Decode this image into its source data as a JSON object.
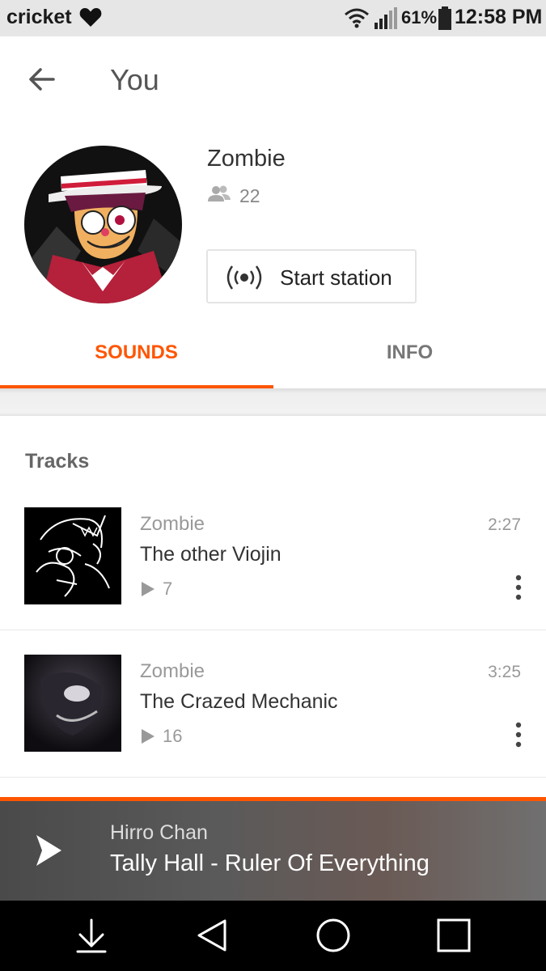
{
  "status_bar": {
    "carrier": "cricket",
    "battery": "61%",
    "time": "12:58 PM"
  },
  "header": {
    "title": "You"
  },
  "profile": {
    "name": "Zombie",
    "followers": "22",
    "station_button": "Start station"
  },
  "tabs": [
    {
      "label": "SOUNDS",
      "active": true
    },
    {
      "label": "INFO",
      "active": false
    }
  ],
  "tracks_section": {
    "title": "Tracks",
    "items": [
      {
        "artist": "Zombie",
        "title": "The other Viojin",
        "plays": "7",
        "duration": "2:27"
      },
      {
        "artist": "Zombie",
        "title": "The Crazed Mechanic",
        "plays": "16",
        "duration": "3:25"
      }
    ]
  },
  "player": {
    "artist": "Hirro Chan",
    "title": "Tally Hall - Ruler Of Everything"
  },
  "colors": {
    "accent": "#ff5500"
  }
}
